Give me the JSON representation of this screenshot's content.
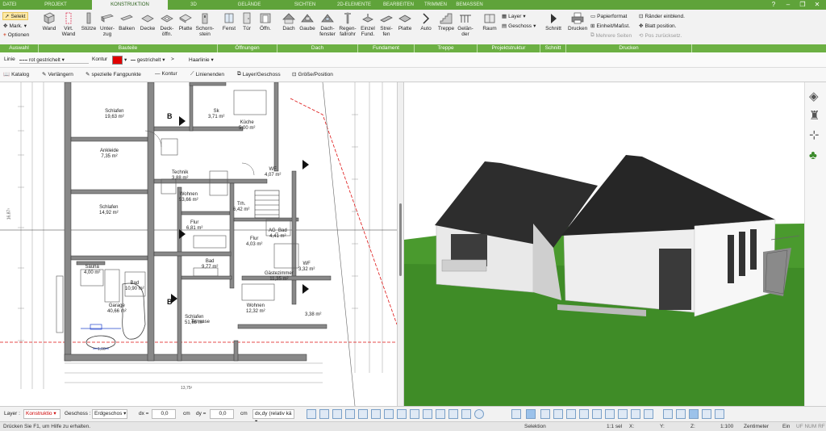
{
  "colors": {
    "accent": "#5fa33a",
    "group_bar": "#6cb043",
    "swatch_red": "#e00000",
    "sky": "#ffffff",
    "grass": "#3d8a25",
    "roof": "#2b2b2b",
    "wall": "#eeeeee"
  },
  "tabs": [
    "DATEI",
    "PROJEKT",
    "KONSTRUKTION",
    "3D",
    "GELÄNDE",
    "SICHTEN",
    "2D-ELEMENTE",
    "BEARBEITEN",
    "TRIMMEN",
    "BEMASSEN"
  ],
  "ribbon": {
    "auswahl": {
      "selekt": "Selekt",
      "mark": "Mark.",
      "optionen": "Optionen"
    },
    "bauteile": [
      "Wand",
      "Virt. Wand",
      "Stütze",
      "Unter- zug",
      "Balken",
      "Decke",
      "Deck- öffn.",
      "Platte",
      "Schorn- stein"
    ],
    "oeffnungen": [
      "Fenst",
      "Tür",
      "Öffn."
    ],
    "dach": [
      "Dach",
      "Gaube",
      "Dach- fenster",
      "Regen- fallrohr"
    ],
    "fundament": [
      "Einzel Fund.",
      "Strei- fen",
      "Platte"
    ],
    "treppe": [
      "Auto",
      "Treppe",
      "Gelän- der"
    ],
    "projektstruktur": {
      "raum": "Raum",
      "layer": "Layer",
      "geschoss": "Geschoss"
    },
    "schnitt": "Schnitt",
    "drucken": {
      "drucken": "Drucken",
      "papierformat": "Papierformat",
      "einheit": "Einheit/Maßst.",
      "mehrere_seiten": "Mehrere Seiten",
      "raender": "Ränder einblend.",
      "blatt": "Blatt position.",
      "pos_zurueck": "Pos zurücksetz."
    },
    "groups": [
      "Auswahl",
      "Bauteile",
      "Öffnungen",
      "Dach",
      "Fundament",
      "Treppe",
      "Projektstruktur",
      "Schnitt",
      "Drucken"
    ]
  },
  "props": {
    "linie": "Linie",
    "linie_value": "rot gestrichelt",
    "kontur": "Kontur",
    "kontur_style": "gestrichelt",
    "haarlinie": "Haarlinie"
  },
  "tools": [
    "Katalog",
    "Verlängern",
    "spezielle Fangpunkte",
    "Kontur",
    "Linienenden",
    "Layer/Geschoss",
    "Größe/Position"
  ],
  "rooms": [
    {
      "name": "Schlafen",
      "area": "19,63 m²"
    },
    {
      "name": "Sk",
      "area": "3,71 m²"
    },
    {
      "name": "Küche",
      "area": "5,00 m²"
    },
    {
      "name": "Ankleide",
      "area": "7,35 m²"
    },
    {
      "name": "Technik",
      "area": "3,88 m²"
    },
    {
      "name": "WF",
      "area": "4,07 m²"
    },
    {
      "name": "Wohnen",
      "area": "53,66 m²"
    },
    {
      "name": "Schlafen",
      "area": "14,92 m²"
    },
    {
      "name": "Trh.",
      "area": "6,42 m²"
    },
    {
      "name": "Flur",
      "area": "6,81 m²"
    },
    {
      "name": "Flur",
      "area": "4,03 m²"
    },
    {
      "name": "AG_Bad",
      "area": "4,41 m²"
    },
    {
      "name": "Sauna",
      "area": "4,00 m²"
    },
    {
      "name": "Bad",
      "area": "9,77 m²"
    },
    {
      "name": "Bad",
      "area": "10,90 m²"
    },
    {
      "name": "WF",
      "area": "3,32 m²"
    },
    {
      "name": "Gästezimmer",
      "area": "11,35 m²"
    },
    {
      "name": "Garage",
      "area": "40,66 m²"
    },
    {
      "name": "Wohnen",
      "area": "12,32 m²"
    },
    {
      "name": "Schlafen",
      "area": "51,65 m²"
    },
    {
      "name": "Terrasse",
      "area": ""
    },
    {
      "name": "",
      "area": "3,38 m²"
    }
  ],
  "dims": {
    "bottom": "13,75²",
    "car": "1,00",
    "left": "16,87⁵"
  },
  "bottom": {
    "layer_label": "Layer :",
    "layer_value": "Konstruktio",
    "geschoss_label": "Geschoss :",
    "geschoss_value": "Erdgeschos",
    "dx_label": "dx =",
    "dx_value": "0,0",
    "dy_label": "dy =",
    "dy_value": "0,0",
    "unit": "cm",
    "mode": "dx,dy (relativ kä"
  },
  "status": {
    "help": "Drücken Sie F1, um Hilfe zu erhalten.",
    "mode": "Selektion",
    "scale": "1:1 sel",
    "x": "X:",
    "y": "Y:",
    "z": "Z:",
    "scale2": "1:100",
    "unit": "Zentimeter",
    "ein": "Ein",
    "flags": "UF NUM RF"
  }
}
